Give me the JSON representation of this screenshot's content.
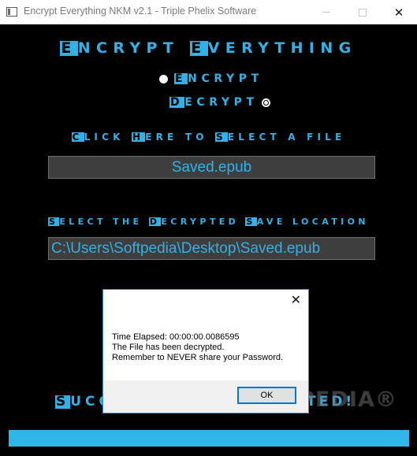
{
  "window": {
    "title": "Encrypt Everything NKM v2.1 - Triple Phelix Software"
  },
  "app": {
    "title_first_a": "E",
    "title_rest_a": "ncrypt ",
    "title_first_b": "E",
    "title_rest_b": "verything",
    "encrypt_first": "E",
    "encrypt_rest": "ncrypt",
    "decrypt_first": "D",
    "decrypt_rest": "ecrypt",
    "selected_mode": "Decrypt",
    "select_file_parts": [
      {
        "first": "C",
        "rest": "lick "
      },
      {
        "first": "H",
        "rest": "ere to "
      },
      {
        "first": "S",
        "rest": "elect a file"
      }
    ],
    "file_field_value": "Saved.epub",
    "select_location_parts": [
      {
        "first": "S",
        "rest": "elect the "
      },
      {
        "first": "D",
        "rest": "ecrypted "
      },
      {
        "first": "S",
        "rest": "ave location"
      }
    ],
    "location_field_value": "C:\\Users\\Softpedia\\Desktop\\Saved.epub",
    "status_visible_start_first": "S",
    "status_visible_start_rest": "ucc",
    "status_visible_end": "ted!",
    "progress_percent": 100,
    "accent_color": "#33b1e6"
  },
  "dialog": {
    "close_glyph": "✕",
    "line1": "Time Elapsed: 00:00:00.0086595",
    "line2": "The File has been decrypted.",
    "line3": "Remember to NEVER share your Password.",
    "ok_label": "OK"
  },
  "watermark": {
    "text": "SOFTPEDIA®"
  }
}
